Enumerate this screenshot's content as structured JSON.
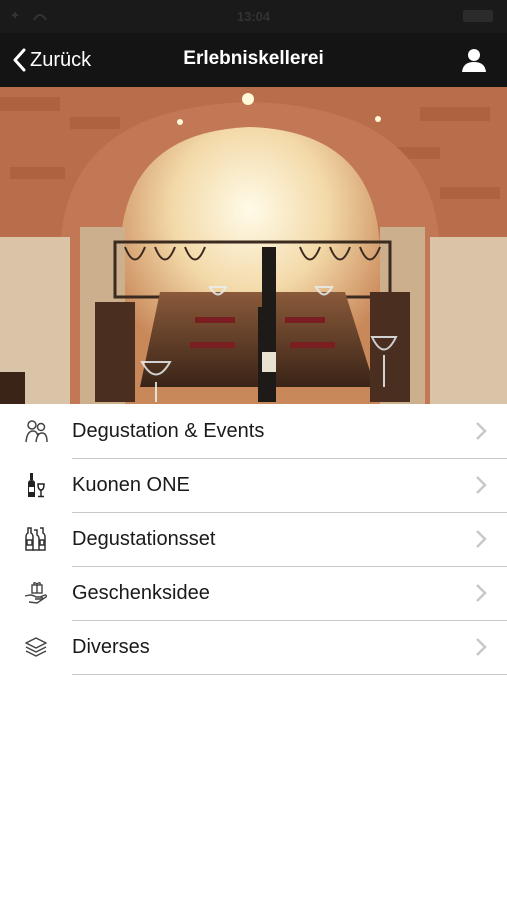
{
  "status_bar": {
    "time": "13:04"
  },
  "nav": {
    "back_label": "Zurück",
    "title": "Erlebniskellerei",
    "user_icon": "user-icon"
  },
  "hero": {
    "description_icon": "wine-cellar-photo"
  },
  "menu": {
    "items": [
      {
        "label": "Degustation & Events",
        "icon": "tasting-people-icon"
      },
      {
        "label": "Kuonen ONE",
        "icon": "wine-bottle-glass-icon"
      },
      {
        "label": "Degustationsset",
        "icon": "bottles-set-icon"
      },
      {
        "label": "Geschenksidee",
        "icon": "gift-hand-icon"
      },
      {
        "label": "Diverses",
        "icon": "layers-icon"
      }
    ]
  },
  "colors": {
    "nav_bg": "#141414",
    "separator": "#c8c7cc",
    "chevron": "#c7c7cc"
  }
}
